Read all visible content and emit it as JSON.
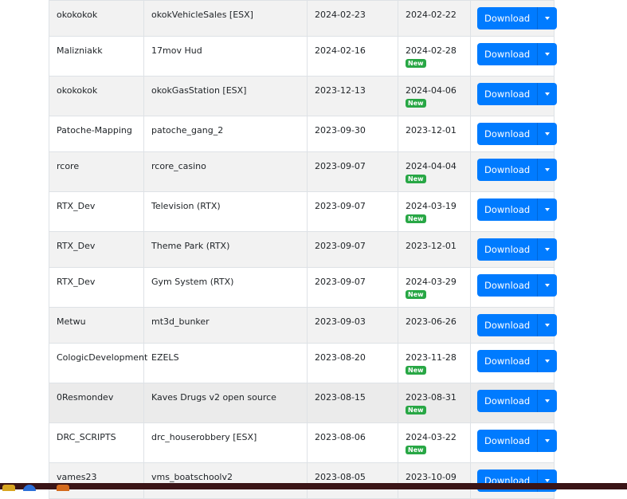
{
  "download_label": "Download",
  "new_label": "New",
  "rows": [
    {
      "author": "okokokok",
      "name": "okokVehicleSales [ESX]",
      "created": "2024-02-23",
      "updated": "2024-02-22",
      "is_new": false
    },
    {
      "author": "Malizniakk",
      "name": "17mov Hud",
      "created": "2024-02-16",
      "updated": "2024-02-28",
      "is_new": true
    },
    {
      "author": "okokokok",
      "name": "okokGasStation [ESX]",
      "created": "2023-12-13",
      "updated": "2024-04-06",
      "is_new": true
    },
    {
      "author": "Patoche-Mapping",
      "name": "patoche_gang_2",
      "created": "2023-09-30",
      "updated": "2023-12-01",
      "is_new": false
    },
    {
      "author": "rcore",
      "name": "rcore_casino",
      "created": "2023-09-07",
      "updated": "2024-04-04",
      "is_new": true
    },
    {
      "author": "RTX_Dev",
      "name": "Television (RTX)",
      "created": "2023-09-07",
      "updated": "2024-03-19",
      "is_new": true
    },
    {
      "author": "RTX_Dev",
      "name": "Theme Park (RTX)",
      "created": "2023-09-07",
      "updated": "2023-12-01",
      "is_new": false
    },
    {
      "author": "RTX_Dev",
      "name": "Gym System (RTX)",
      "created": "2023-09-07",
      "updated": "2024-03-29",
      "is_new": true
    },
    {
      "author": "Metwu",
      "name": "mt3d_bunker",
      "created": "2023-09-03",
      "updated": "2023-06-26",
      "is_new": false
    },
    {
      "author": "CologicDevelopment",
      "name": "EZELS",
      "created": "2023-08-20",
      "updated": "2023-11-28",
      "is_new": true
    },
    {
      "author": "0Resmondev",
      "name": "Kaves Drugs v2 open source",
      "created": "2023-08-15",
      "updated": "2023-08-31",
      "is_new": true
    },
    {
      "author": "DRC_SCRIPTS",
      "name": "drc_houserobbery [ESX]",
      "created": "2023-08-06",
      "updated": "2024-03-22",
      "is_new": true
    },
    {
      "author": "vames23",
      "name": "vms_boatschoolv2",
      "created": "2023-08-05",
      "updated": "2023-10-09",
      "is_new": false
    }
  ],
  "colors": {
    "button": "#007bff",
    "new_badge": "#28a745",
    "taskbar": "#3a1416"
  },
  "icons": [
    "file-explorer-icon",
    "chrome-icon",
    "app-icon"
  ]
}
